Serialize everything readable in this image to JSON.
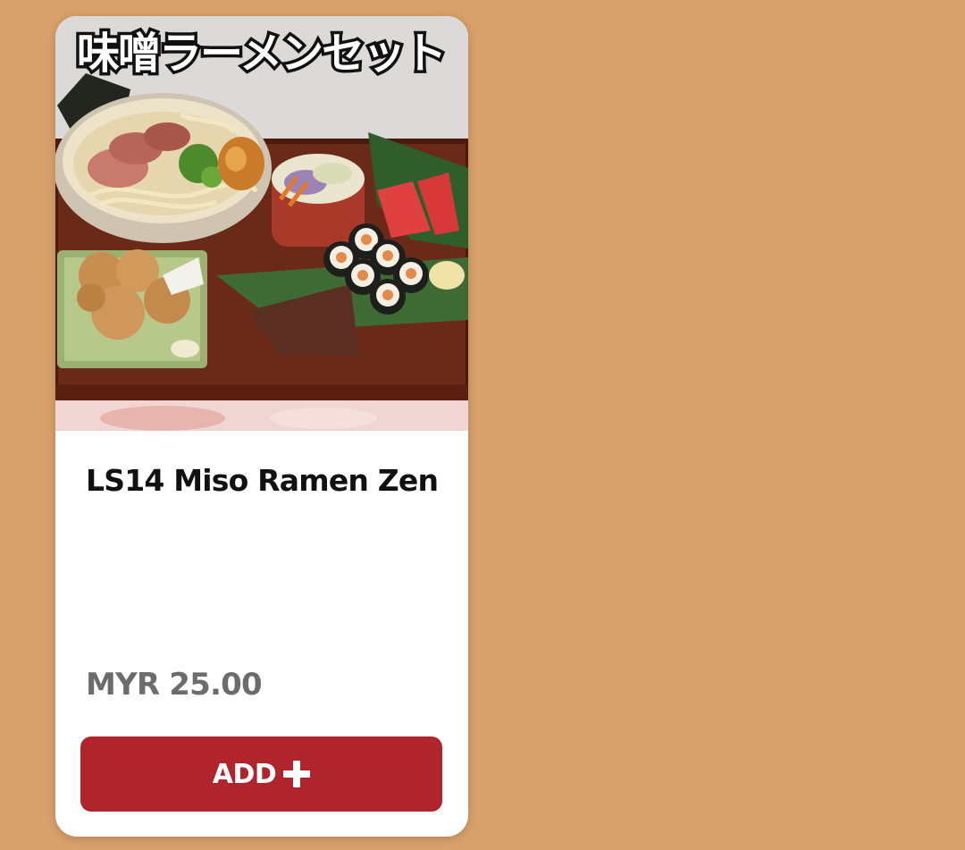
{
  "product": {
    "image_caption": "味噌ラーメンセット",
    "name": "LS14 Miso Ramen Zen",
    "price": "MYR 25.00",
    "add_button_label": "ADD",
    "add_button_icon": "plus-icon",
    "image_subject": "miso-ramen-set-photo"
  },
  "colors": {
    "background": "#D8A06B",
    "card": "#FFFFFF",
    "add_button": "#B0242B",
    "price_text": "#6C6C6C",
    "name_text": "#111111"
  }
}
